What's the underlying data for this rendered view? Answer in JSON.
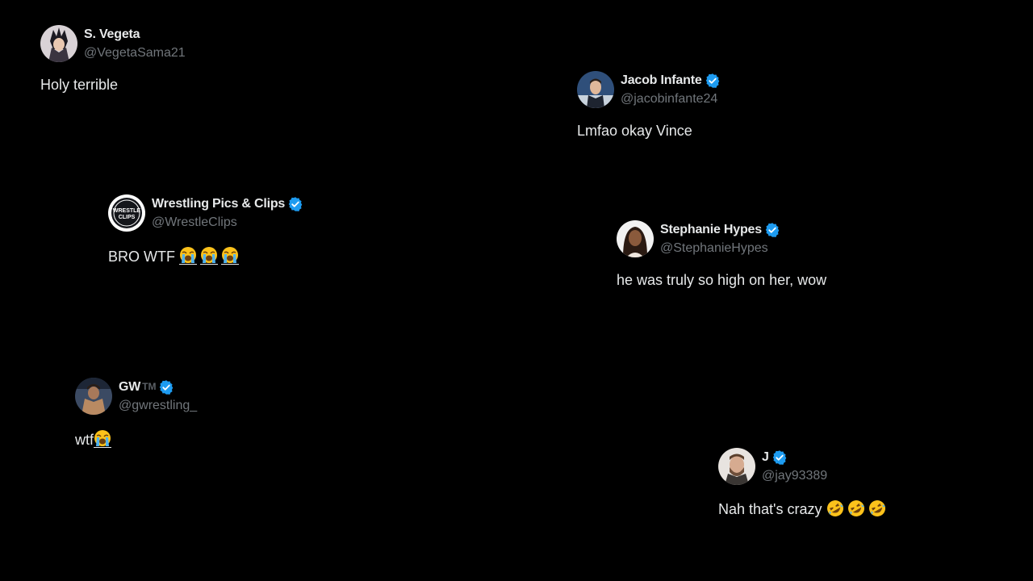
{
  "tweets": [
    {
      "name": "S. Vegeta",
      "handle": "@VegetaSama21",
      "text": "Holy terrible",
      "verified": false,
      "avatar_icon": "vegeta-avatar-icon"
    },
    {
      "name": "Jacob Infante",
      "handle": "@jacobinfante24",
      "text": "Lmfao okay Vince",
      "verified": true,
      "avatar_icon": "newsdesk-avatar-icon"
    },
    {
      "name": "Wrestling Pics & Clips",
      "handle": "@WrestleClips",
      "text": "BRO WTF",
      "emoji": "😭😭😭",
      "verified": true,
      "avatar_icon": "wrestle-clips-logo-icon",
      "logo_text": [
        "WRESTLE",
        "CLIPS"
      ]
    },
    {
      "name": "Stephanie Hypes",
      "handle": "@StephanieHypes",
      "text": "he was truly so high on her, wow",
      "verified": true,
      "avatar_icon": "portrait-avatar-icon"
    },
    {
      "name": "GW",
      "name_suffix": "TM",
      "handle": "@gwrestling_",
      "text": "wtf",
      "emoji": "😭",
      "verified": true,
      "avatar_icon": "wrestler-avatar-icon"
    },
    {
      "name": "J",
      "handle": "@jay93389",
      "text": "Nah that's crazy",
      "emoji": "🤣🤣🤣",
      "verified": true,
      "avatar_icon": "bearded-man-avatar-icon"
    }
  ],
  "colors": {
    "background": "#000000",
    "primary_text": "#e7e9ea",
    "secondary_text": "#71767b",
    "verified_badge": "#1d9bf0"
  }
}
